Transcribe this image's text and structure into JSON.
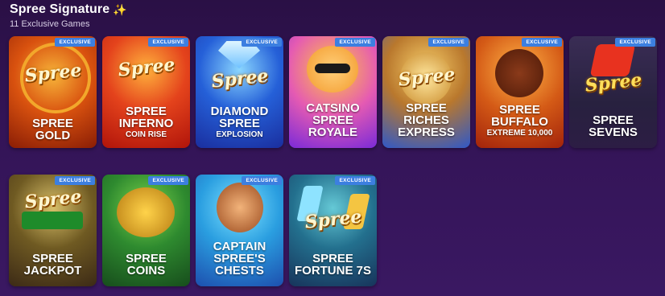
{
  "section": {
    "title": "Spree Signature",
    "sparkle_icon": "sparkles-icon",
    "subtitle": "11 Exclusive Games"
  },
  "badge_label": "EXCLUSIVE",
  "games": [
    {
      "id": "gold",
      "line1": "SPREE",
      "line2": "GOLD",
      "sub": "",
      "logo": "Spree"
    },
    {
      "id": "inferno",
      "line1": "SPREE",
      "line2": "INFERNO",
      "sub": "COIN RISE",
      "logo": "Spree"
    },
    {
      "id": "diamond",
      "line1": "DIAMOND",
      "line2": "SPREE",
      "sub": "EXPLOSION",
      "logo": "Spree"
    },
    {
      "id": "catsino",
      "line1": "CATSINO",
      "line2": "SPREE",
      "sub": "ROYALE",
      "logo": ""
    },
    {
      "id": "riches",
      "line1": "SPREE",
      "line2": "RICHES",
      "sub": "EXPRESS",
      "logo": "Spree"
    },
    {
      "id": "buffalo",
      "line1": "SPREE",
      "line2": "BUFFALO",
      "sub": "EXTREME 10,000",
      "logo": ""
    },
    {
      "id": "sevens",
      "line1": "SPREE",
      "line2": "SEVENS",
      "sub": "",
      "logo": "Spree"
    },
    {
      "id": "jackpot",
      "line1": "SPREE",
      "line2": "JACKPOT",
      "sub": "",
      "logo": "Spree"
    },
    {
      "id": "coins",
      "line1": "SPREE",
      "line2": "COINS",
      "sub": "",
      "logo": ""
    },
    {
      "id": "chests",
      "line1": "CAPTAIN",
      "line2": "SPREE'S",
      "sub": "CHESTS",
      "logo": ""
    },
    {
      "id": "fortune",
      "line1": "SPREE",
      "line2": "FORTUNE 7S",
      "sub": "",
      "logo": "Spree"
    }
  ],
  "colors": {
    "background": "#331456",
    "badge": "#3c7fe0",
    "sparkle": "#ffd34a"
  }
}
